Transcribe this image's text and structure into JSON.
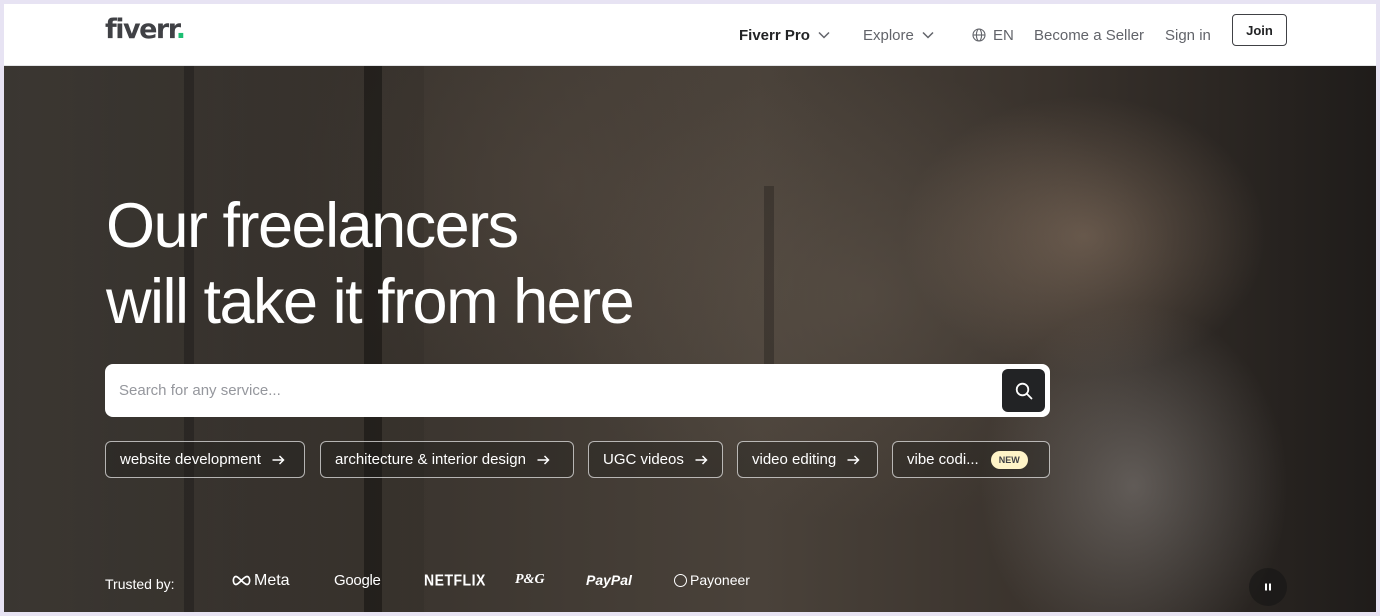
{
  "header": {
    "logo_text": "fiverr",
    "logo_dot": ".",
    "nav": {
      "pro": "Fiverr Pro",
      "explore": "Explore",
      "language": "EN",
      "become_seller": "Become a Seller",
      "sign_in": "Sign in",
      "join": "Join"
    }
  },
  "hero": {
    "headline_line1": "Our freelancers",
    "headline_line2": "will take it from here",
    "search": {
      "placeholder": "Search for any service...",
      "value": ""
    },
    "chips": [
      {
        "label": "website development"
      },
      {
        "label": "architecture & interior design"
      },
      {
        "label": "UGC videos"
      },
      {
        "label": "video editing"
      },
      {
        "label": "vibe codi...",
        "badge": "NEW"
      }
    ],
    "trusted": {
      "label": "Trusted by:",
      "brands": [
        "Meta",
        "Google",
        "NETFLIX",
        "P&G",
        "PayPal",
        "Payoneer"
      ]
    }
  },
  "colors": {
    "brand_green": "#1dbf73",
    "text_dark": "#222325",
    "search_button": "#222325",
    "badge_bg": "#fff4c8"
  },
  "icons": {
    "search_button": "search-icon",
    "language": "globe-icon",
    "dropdown": "chevron-down-icon",
    "chip": "arrow-right-icon",
    "media": "pause-icon"
  }
}
